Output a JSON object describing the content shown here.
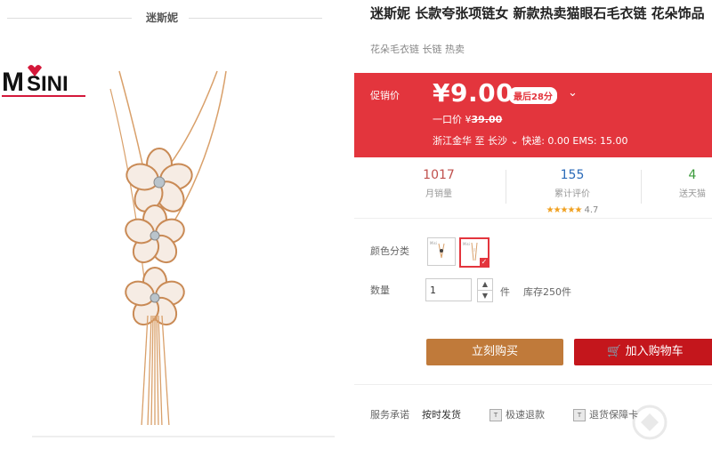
{
  "brand": {
    "name": "迷斯妮",
    "logo_text": "MISINI"
  },
  "product": {
    "title": "迷斯妮 长款夸张项链女 新款热卖猫眼石毛衣链 花朵饰品",
    "subtitle": "花朵毛衣链 长链 热卖"
  },
  "promo": {
    "label": "促销价",
    "price": "¥9.00",
    "badge": "最后28分",
    "original_label": "一口价 ¥",
    "original_price": "39.00",
    "ship_from": "浙江金华",
    "ship_to_label": "至",
    "ship_to": "长沙",
    "shipping": "快递: 0.00 EMS: 15.00"
  },
  "stats": {
    "monthly_sales": "1017",
    "monthly_sales_label": "月销量",
    "reviews": "155",
    "reviews_label": "累计评价",
    "rating": "4.7",
    "points": "4",
    "points_label": "送天猫"
  },
  "options": {
    "color_label": "颜色分类",
    "quantity_label": "数量",
    "quantity": "1",
    "unit": "件",
    "stock": "库存250件"
  },
  "actions": {
    "buy_now": "立刻购买",
    "add_to_cart": "加入购物车"
  },
  "service": {
    "label": "服务承诺",
    "items": [
      "按时发货",
      "极速退款",
      "退货保障卡"
    ]
  },
  "colors": {
    "promo_bg": "#e3353d",
    "buy_btn": "#c07a3a",
    "cart_btn": "#c4161c"
  }
}
